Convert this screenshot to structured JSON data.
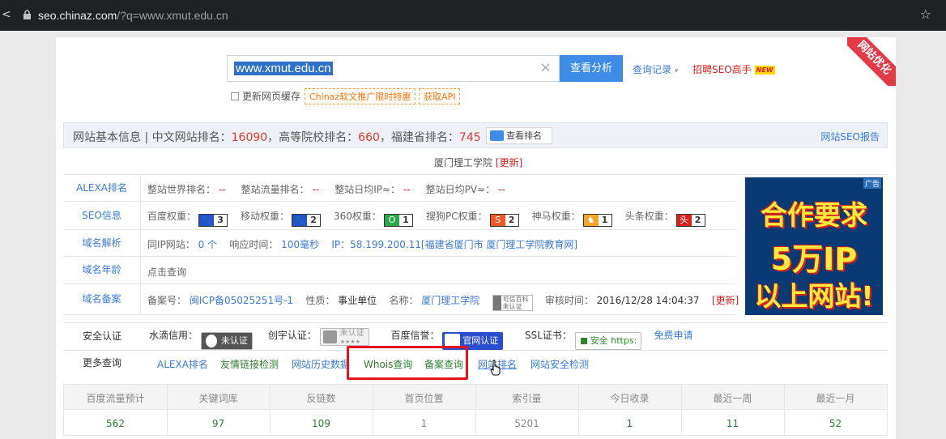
{
  "browser": {
    "url_host": "seo.chinaz.com",
    "url_path": "/?q=www.xmut.edu.cn",
    "back": "<",
    "star": "☆"
  },
  "corner": {
    "text": "网站优化"
  },
  "search": {
    "value": "www.xmut.edu.cn",
    "clear": "×",
    "button": "查看分析",
    "history": "查询记录",
    "history_arrow": "▾",
    "hire": "招聘SEO高手",
    "new_badge": "NEW"
  },
  "options": {
    "cache": "更新网页缓存",
    "promo1": "Chinaz软文推广限时特惠",
    "promo2": "获取API"
  },
  "basic": {
    "title": "网站基本信息",
    "sep": "|",
    "cn_label": "中文网站排名：",
    "cn_rank": "16090",
    "hs_label": "，高等院校排名：",
    "hs_rank": "660",
    "fj_label": "，福建省排名：",
    "fj_rank": "745",
    "rank_btn": "查看排名",
    "report": "网站SEO报告"
  },
  "site": {
    "name": "厦门理工学院",
    "update": "[更新]"
  },
  "alexa": {
    "label": "ALEXA排名",
    "world": "整站世界排名：",
    "world_v": "--",
    "flow": "整站流量排名：",
    "flow_v": "--",
    "ip": "整站日均IP≈：",
    "ip_v": "--",
    "pv": "整站日均PV≈：",
    "pv_v": "--"
  },
  "seo": {
    "label": "SEO信息",
    "items": [
      {
        "name": "百度权重：",
        "v": "3",
        "bg": "#2452c8",
        "ico": "🐾"
      },
      {
        "name": "移动权重：",
        "v": "2",
        "bg": "#2452c8",
        "ico": "🐾"
      },
      {
        "name": "360权重：",
        "v": "1",
        "bg": "#2aa84a",
        "ico": "O"
      },
      {
        "name": "搜狗PC权重：",
        "v": "2",
        "bg": "#f15a24",
        "ico": "S"
      },
      {
        "name": "神马权重：",
        "v": "1",
        "bg": "#f5a623",
        "ico": "♞"
      },
      {
        "name": "头条权重：",
        "v": "2",
        "bg": "#d9201b",
        "ico": "头"
      }
    ]
  },
  "domain": {
    "label": "域名解析",
    "sameip": "同IP网站：",
    "sameip_v": "0 个",
    "resp": "响应时间：",
    "resp_v": "100毫秒",
    "ip": "IP：58.199.200.11[福建省厦门市 厦门理工学院教育网]"
  },
  "age": {
    "label": "域名年龄",
    "link": "点击查询"
  },
  "icp": {
    "label": "域名备案",
    "no_l": "备案号：",
    "no": "闽ICP备05025251号-1",
    "nature_l": "性质：",
    "nature": "事业单位",
    "name_l": "名称：",
    "name": "厦门理工学院",
    "baike1": "可信百科",
    "baike2": "未认证",
    "time_l": "审核时间：",
    "time": "2016/12/28 14:04:37",
    "update": "[更新]"
  },
  "ad": {
    "tag": "广告",
    "l1": "合作要求",
    "l2": "5万IP",
    "l3": "以上网站!"
  },
  "security": {
    "label": "安全认证",
    "water": "水滴信用：",
    "unver": "未认证",
    "chuangyu": "创宇认证：",
    "unver2": "未认证",
    "stars": "★★★★",
    "baidu": "百度信誉：",
    "official": "官网认证",
    "ssl": "SSL证书：",
    "https": "安全 https:",
    "apply": "免费申请"
  },
  "more": {
    "label": "更多查询",
    "links": [
      "ALEXA排名",
      "友情链接检测",
      "网站历史数据",
      "Whois查询",
      "备案查询",
      "网站排名",
      "网站安全检测"
    ]
  },
  "stats": {
    "headers": [
      "百度流量预计",
      "关键词库",
      "反链数",
      "首页位置",
      "索引量",
      "今日收录",
      "最近一周",
      "最近一月"
    ],
    "values": [
      "562",
      "97",
      "109",
      "1",
      "5201",
      "1",
      "11",
      "52"
    ]
  },
  "colors": {
    "link": "#3a7bd5",
    "red": "#d9201b",
    "highlight": "#e5141b",
    "btn": "#3d8de6"
  }
}
